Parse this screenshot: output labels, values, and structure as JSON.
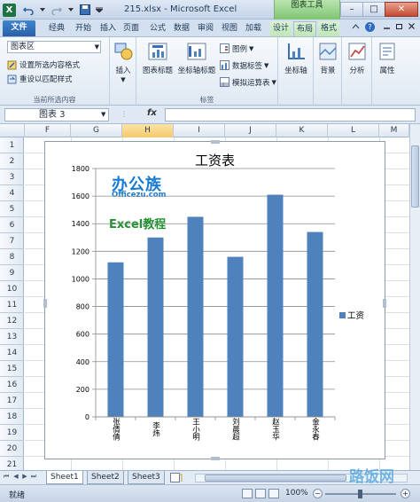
{
  "window": {
    "title": "215.xlsx - Microsoft Excel",
    "context_group": "图表工具",
    "minimize": "–",
    "maximize": "□",
    "close": "✕"
  },
  "tabs": [
    {
      "label": "文件"
    },
    {
      "label": "经典"
    },
    {
      "label": "开始"
    },
    {
      "label": "插入"
    },
    {
      "label": "页面"
    },
    {
      "label": "公式"
    },
    {
      "label": "数据"
    },
    {
      "label": "审阅"
    },
    {
      "label": "视图"
    },
    {
      "label": "加载"
    },
    {
      "label": "设计"
    },
    {
      "label": "布局"
    },
    {
      "label": "格式"
    }
  ],
  "ribbon": {
    "current_selection": {
      "dropdown_value": "图表区",
      "format_selection": "设置所选内容格式",
      "reset_style": "重设以匹配样式",
      "group_label": "当前所选内容"
    },
    "insert": {
      "label": "插入"
    },
    "labels": {
      "chart_title": "图表标题",
      "axis_titles": "坐标轴标题",
      "legend": "图例",
      "data_labels": "数据标签",
      "data_table": "模拟运算表",
      "group_label": "标签"
    },
    "axes": {
      "label": "坐标轴"
    },
    "background": {
      "label": "背景"
    },
    "analysis": {
      "label": "分析"
    },
    "properties": {
      "label": "属性"
    }
  },
  "formula_bar": {
    "name_box": "图表 3",
    "fx": "fx"
  },
  "columns": [
    "F",
    "G",
    "H",
    "I",
    "J",
    "K",
    "L",
    "M"
  ],
  "rows": [
    "1",
    "2",
    "3",
    "4",
    "5",
    "6",
    "7",
    "8",
    "9",
    "10",
    "11",
    "12",
    "13",
    "14",
    "15",
    "16",
    "17",
    "18",
    "19",
    "20",
    "21"
  ],
  "watermarks": {
    "brand": "办公族",
    "site": "Officezu.com",
    "course": "Excel教程",
    "corner": "路饭网"
  },
  "chart_data": {
    "type": "bar",
    "title": "工资表",
    "categories": [
      "张倩倩",
      "李炜",
      "王小明",
      "刘晨超",
      "赵玉华",
      "金永春"
    ],
    "series": [
      {
        "name": "工资",
        "values": [
          1120,
          1300,
          1450,
          1160,
          1610,
          1340
        ]
      }
    ],
    "ylim": [
      0,
      1800
    ],
    "yticks": [
      "0",
      "200",
      "400",
      "600",
      "800",
      "1000",
      "1200",
      "1400",
      "1600",
      "1800"
    ],
    "grid": true,
    "legend": "right",
    "color": "#4f81bd"
  },
  "sheets": [
    {
      "label": "Sheet1"
    },
    {
      "label": "Sheet2"
    },
    {
      "label": "Sheet3"
    }
  ],
  "status": {
    "text": "就绪",
    "zoom": "100%",
    "zoom_out": "−",
    "zoom_in": "+"
  }
}
